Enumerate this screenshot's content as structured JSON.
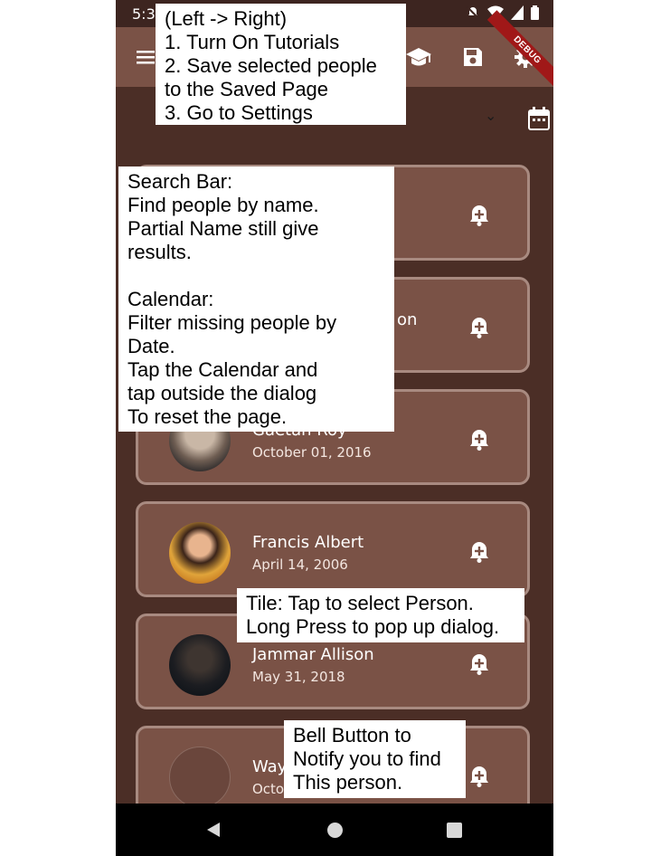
{
  "status_bar": {
    "time": "5:3"
  },
  "debug_banner": "DEBUG",
  "people": [
    {
      "name": "",
      "date": ""
    },
    {
      "name": "on",
      "date": ""
    },
    {
      "name": "Gaetan Roy",
      "date": "October 01, 2016"
    },
    {
      "name": "Francis Albert",
      "date": "April 14, 2006"
    },
    {
      "name": "Jammar Allison",
      "date": "May 31, 2018"
    },
    {
      "name": "Way",
      "date": "Octo"
    }
  ],
  "annotations": {
    "appbar_note": [
      "(Left -> Right)",
      "1. Turn On Tutorials",
      "2. Save selected people",
      "to the Saved Page",
      "3. Go to Settings"
    ],
    "search_note": [
      "Search Bar:",
      "Find people by name.",
      "Partial Name still give",
      "results.",
      "",
      "Calendar:",
      "Filter missing people by",
      "Date.",
      "Tap the Calendar and",
      "tap outside the dialog",
      "To reset the page."
    ],
    "tile_note": [
      "Tile: Tap to select Person.",
      "Long Press to pop up dialog."
    ],
    "bell_note": [
      "Bell Button to",
      "Notify you to find",
      "This person."
    ]
  },
  "icons": {
    "menu": "menu-icon",
    "tutorials": "school-icon",
    "save": "save-icon",
    "settings": "gear-icon",
    "calendar": "calendar-icon",
    "bell": "bell-plus-icon",
    "dropdown": "chevron-down-icon"
  },
  "colors": {
    "background": "#4b2e26",
    "appbar": "#7a5246",
    "tile": "#7a5246",
    "tile_border": "#a88a80",
    "debug": "#a01818"
  }
}
